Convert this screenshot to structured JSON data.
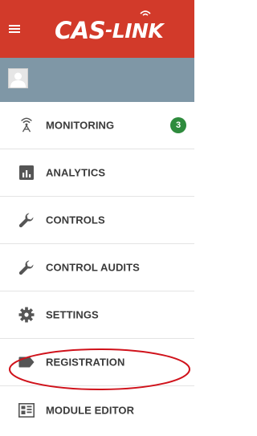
{
  "header": {
    "brand_part1": "CAS",
    "brand_dash": "-",
    "brand_part2": "LINK",
    "bg_color": "#d23a2a"
  },
  "user_bar": {
    "bg_color": "#7f97a6",
    "avatar_icon": "user-avatar-icon"
  },
  "menu": {
    "items": [
      {
        "label": "MONITORING",
        "icon": "antenna-icon",
        "badge": "3"
      },
      {
        "label": "ANALYTICS",
        "icon": "bar-chart-icon"
      },
      {
        "label": "CONTROLS",
        "icon": "wrench-icon"
      },
      {
        "label": "CONTROL AUDITS",
        "icon": "wrench-icon"
      },
      {
        "label": "SETTINGS",
        "icon": "gear-icon"
      },
      {
        "label": "REGISTRATION",
        "icon": "label-tag-icon"
      },
      {
        "label": "MODULE EDITOR",
        "icon": "module-editor-icon"
      }
    ],
    "badge_color": "#2e8b3d",
    "highlight_color": "#d0121b"
  }
}
